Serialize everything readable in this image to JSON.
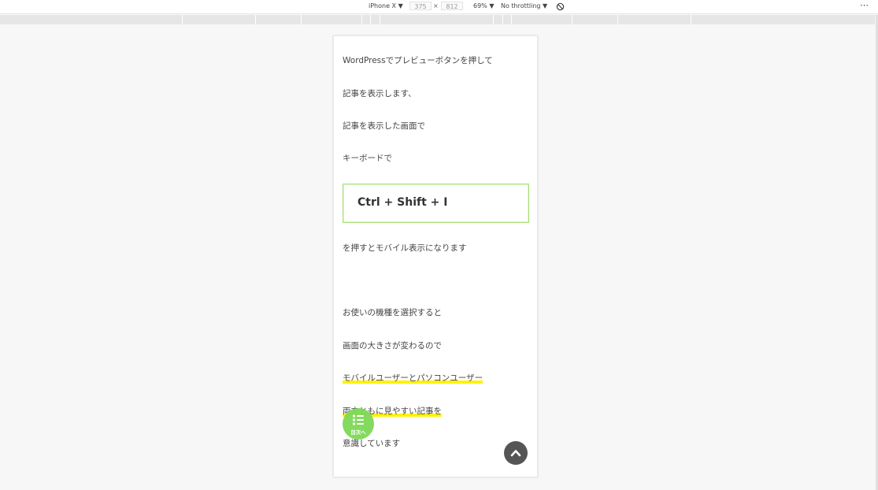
{
  "devtools": {
    "device_name": "iPhone X ▼",
    "width": "375",
    "times": "×",
    "height": "812",
    "zoom": "69% ▼",
    "throttling": "No throttling ▼",
    "more": "⋯"
  },
  "article": {
    "lines": [
      "WordPressでプレビューボタンを押して",
      "記事を表示します、",
      "記事を表示した画面で",
      "キーボードで",
      "を押すとモバイル表示になります",
      "お使いの機種を選択すると",
      "画面の大きさが変わるので",
      "モバイルユーザーとパソコンユーザー",
      "両方ともに見やすい記事を",
      "意識しています"
    ],
    "shortcut": "Ctrl + Shift + I"
  },
  "toc_button": {
    "label": "目次へ",
    "icon": "list-icon",
    "color": "#7ed957"
  },
  "scroll_top_button": {
    "icon": "chevron-up-icon",
    "color": "#555555"
  },
  "colors": {
    "highlight": "#fff200",
    "shortcut_border": "#a8e07a"
  }
}
